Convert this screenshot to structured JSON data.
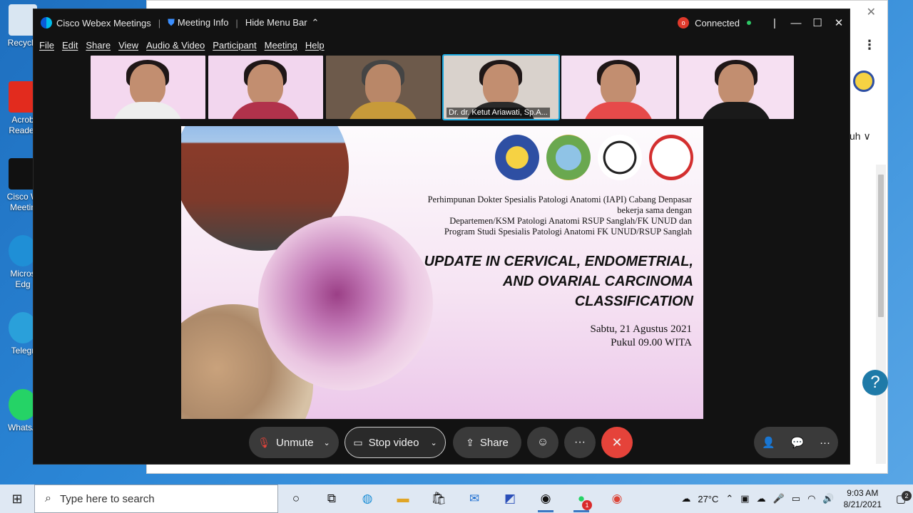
{
  "desktop": {
    "icons": [
      {
        "label": "Recycle",
        "color": "#d9e6f2"
      },
      {
        "label": "Acrob Reader",
        "color": "#e22b1e"
      },
      {
        "label": "Cisco W Meetin",
        "color": "#111111"
      },
      {
        "label": "Micros Edg",
        "color": "#1f8fd6"
      },
      {
        "label": "Telegr",
        "color": "#2aa0da"
      },
      {
        "label": "WhatsA",
        "color": "#25d366"
      }
    ]
  },
  "bg_window": {
    "close": "✕",
    "menu_dots": "⋮",
    "side_text": "uh ∨",
    "help": "?"
  },
  "webex": {
    "app_title": "Cisco Webex Meetings",
    "meeting_info": "Meeting Info",
    "hide_menu": "Hide Menu Bar",
    "status": "Connected",
    "recording_indicator": "o",
    "window_controls": {
      "minimize": "—",
      "maximize": "☐",
      "close": "✕"
    },
    "menu": [
      "File",
      "Edit",
      "Share",
      "View",
      "Audio & Video",
      "Participant",
      "Meeting",
      "Help"
    ],
    "thumbnails": [
      {
        "bg": "#f4d8ef",
        "body": "#eeeeee",
        "label": "",
        "active": false
      },
      {
        "bg": "#f2d6ee",
        "body": "#b1324b",
        "label": "",
        "active": false
      },
      {
        "bg": "#6d5a4b",
        "body": "#c79a3a",
        "label": "",
        "active": false
      },
      {
        "bg": "#d9d2cc",
        "body": "#2a2a2a",
        "label": "Dr. dr. Ketut Ariawati, Sp.A...",
        "active": true
      },
      {
        "bg": "#f4dff1",
        "body": "#e64a4a",
        "label": "",
        "active": false
      },
      {
        "bg": "#f6e0f2",
        "body": "#1a1a1a",
        "label": "",
        "active": false
      }
    ],
    "slide": {
      "org_lines": [
        "Perhimpunan Dokter Spesialis Patologi Anatomi (IAPI) Cabang Denpasar",
        "bekerja sama dengan",
        "Departemen/KSM Patologi Anatomi RSUP Sanglah/FK UNUD dan",
        "Program Studi Spesialis Patologi Anatomi FK UNUD/RSUP Sanglah"
      ],
      "title_lines": [
        "UPDATE IN CERVICAL, ENDOMETRIAL,",
        "AND OVARIAL CARCINOMA",
        "CLASSIFICATION"
      ],
      "date_lines": [
        "Sabtu, 21 Agustus 2021",
        "Pukul 09.00 WITA"
      ],
      "logo_colors": [
        "#2e4fa3",
        "#6aa84f",
        "#222222",
        "#d32f2f"
      ]
    },
    "controls": {
      "unmute": "Unmute",
      "stop_video": "Stop video",
      "share": "Share",
      "more": "···",
      "end": "✕"
    }
  },
  "taskbar": {
    "search_placeholder": "Type here to search",
    "weather": "27°C",
    "time": "9:03 AM",
    "date": "8/21/2021",
    "notifications": "2",
    "whatsapp_badge": "1"
  }
}
